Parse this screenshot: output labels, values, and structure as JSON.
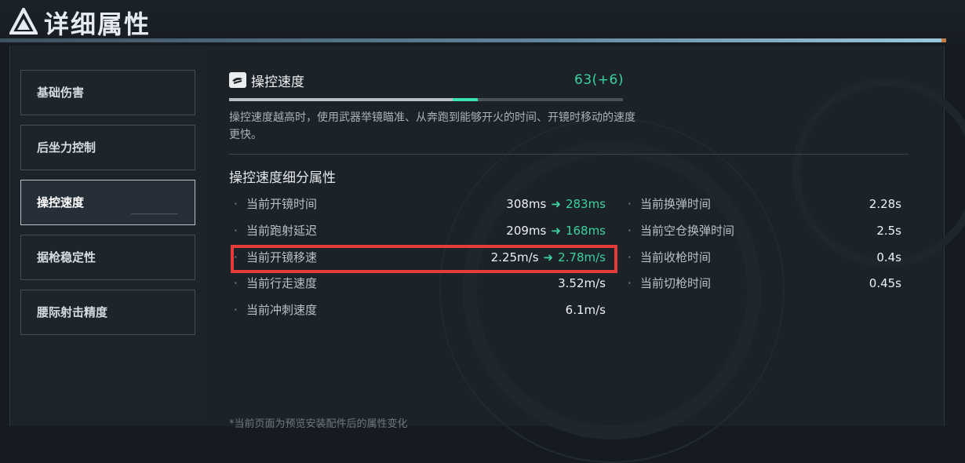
{
  "header": {
    "title": "详细属性"
  },
  "sidebar": {
    "items": [
      {
        "label": "基础伤害"
      },
      {
        "label": "后坐力控制"
      },
      {
        "label": "操控速度"
      },
      {
        "label": "据枪稳定性"
      },
      {
        "label": "腰际射击精度"
      }
    ],
    "active_index": 2
  },
  "stat": {
    "icon": "handling-icon",
    "title": "操控速度",
    "value": "63(+6)",
    "base_fraction": 0.567,
    "boost_fraction": 0.063,
    "description": "操控速度越高时，使用武器举镜瞄准、从奔跑到能够开火的时间、开镜时移动的速度更快。"
  },
  "breakdown": {
    "title": "操控速度细分属性",
    "left": [
      {
        "name": "当前开镜时间",
        "value": "308ms",
        "arrow": "➜",
        "new_value": "283ms"
      },
      {
        "name": "当前跑射延迟",
        "value": "209ms",
        "arrow": "➜",
        "new_value": "168ms"
      },
      {
        "name": "当前开镜移速",
        "value": "2.25m/s",
        "arrow": "➜",
        "new_value": "2.78m/s"
      },
      {
        "name": "当前行走速度",
        "value": "3.52m/s"
      },
      {
        "name": "当前冲刺速度",
        "value": "6.1m/s"
      }
    ],
    "right": [
      {
        "name": "当前换弹时间",
        "value": "2.28s"
      },
      {
        "name": "当前空仓换弹时间",
        "value": "2.5s"
      },
      {
        "name": "当前收枪时间",
        "value": "0.4s"
      },
      {
        "name": "当前切枪时间",
        "value": "0.45s"
      }
    ],
    "bullet": "·"
  },
  "footnote": "*当前页面为预览安装配件后的属性变化",
  "colors": {
    "accent_green": "#3cd2a0",
    "highlight_red": "#e53b3b"
  }
}
